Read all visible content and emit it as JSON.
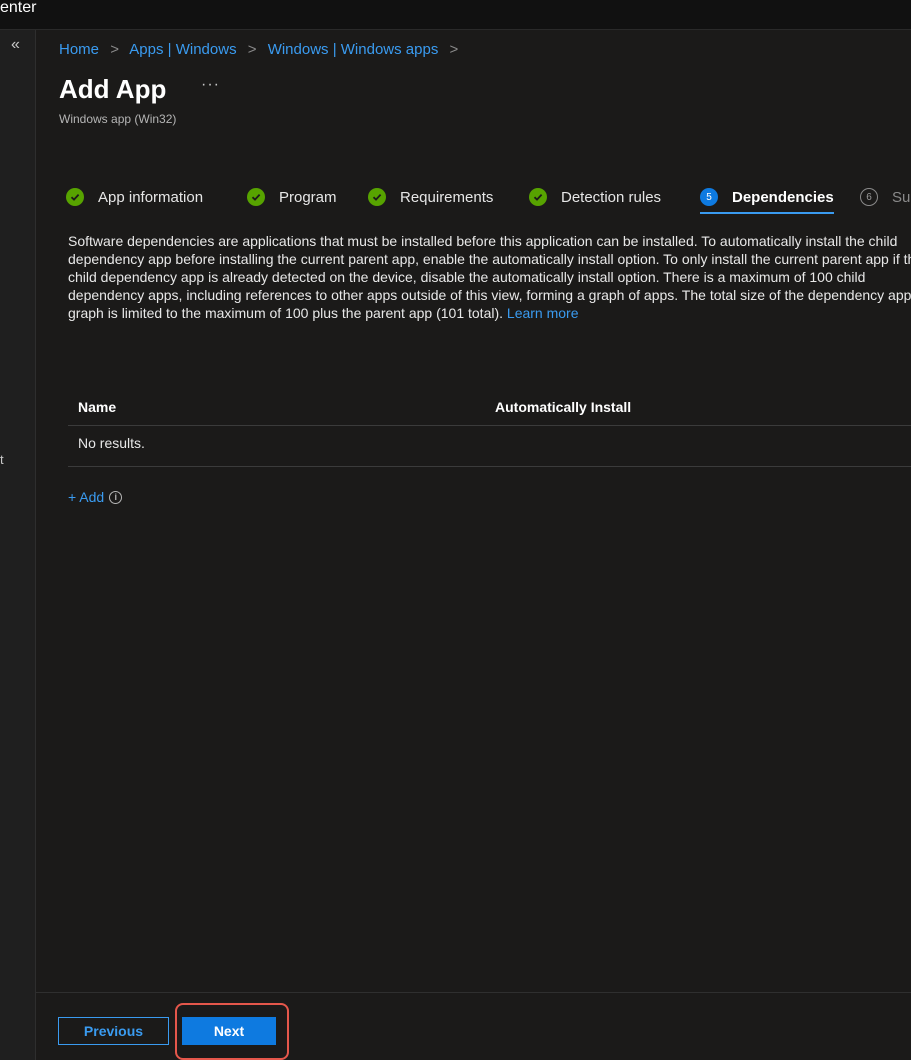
{
  "topbar": {
    "title": "enter"
  },
  "sidebar": {
    "collapse_glyph": "«",
    "stub_text": "t"
  },
  "breadcrumb": {
    "items": [
      "Home",
      "Apps | Windows",
      "Windows | Windows apps"
    ],
    "separator": ">"
  },
  "header": {
    "title": "Add App",
    "more_glyph": "···",
    "subtitle": "Windows app (Win32)"
  },
  "steps": [
    {
      "label": "App information",
      "state": "complete"
    },
    {
      "label": "Program",
      "state": "complete"
    },
    {
      "label": "Requirements",
      "state": "complete"
    },
    {
      "label": "Detection rules",
      "state": "complete"
    },
    {
      "number": "5",
      "label": "Dependencies",
      "state": "active"
    },
    {
      "number": "6",
      "label": "Su",
      "state": "upcoming"
    }
  ],
  "description": {
    "text": "Software dependencies are applications that must be installed before this application can be installed. To automatically install the child dependency app before installing the current parent app, enable the automatically install option. To only install the current parent app if the child dependency app is already detected on the device, disable the automatically install option. There is a maximum of 100 child dependency apps, including references to other apps outside of this view, forming a graph of apps. The total size of the dependency app graph is limited to the maximum of 100 plus the parent app (101 total).",
    "link": "Learn more"
  },
  "table": {
    "columns": [
      "Name",
      "Automatically Install"
    ],
    "empty_text": "No results."
  },
  "add": {
    "label": "+ Add",
    "info_glyph": "i"
  },
  "footer": {
    "previous_label": "Previous",
    "next_label": "Next"
  },
  "colors": {
    "accent": "#3a9bf0",
    "primary_button": "#0e7ae0",
    "complete_check": "#57a300",
    "highlight": "#e5574b"
  }
}
